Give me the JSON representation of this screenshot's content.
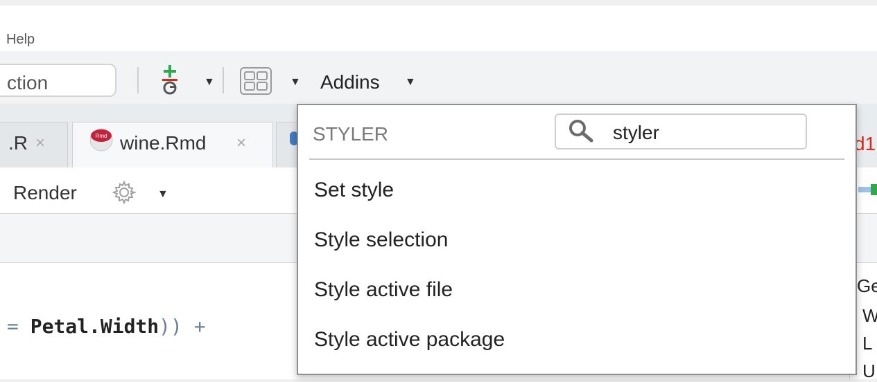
{
  "menubar": {
    "help_label": "Help"
  },
  "toolbar": {
    "goto_input_value": "ction",
    "addins_label": "Addins"
  },
  "tabs": [
    {
      "label": ".R",
      "close": "×"
    },
    {
      "label": "wine.Rmd",
      "close": "×",
      "icon_text": "Rmd"
    }
  ],
  "editor_toolbar": {
    "render_label": "Render"
  },
  "editor": {
    "code": {
      "prefix": "= ",
      "identifier": "Petal.Width",
      "suffix": ")) +"
    }
  },
  "right_pane": {
    "tab_fragment": "d1",
    "lines": [
      "Ge",
      "W",
      "L",
      "U"
    ]
  },
  "addins_dropdown": {
    "section_label": "STYLER",
    "search_value": "styler",
    "items": [
      "Set style",
      "Style selection",
      "Style active file",
      "Style active package"
    ]
  },
  "colors": {
    "accent_red": "#d7281c",
    "addin_icon_green": "#2fa84f",
    "rmd_icon": "#c4213d"
  },
  "icons": [
    "addin-git-icon",
    "grid-layout-icon",
    "gear-icon",
    "search-icon",
    "rmd-file-icon"
  ]
}
